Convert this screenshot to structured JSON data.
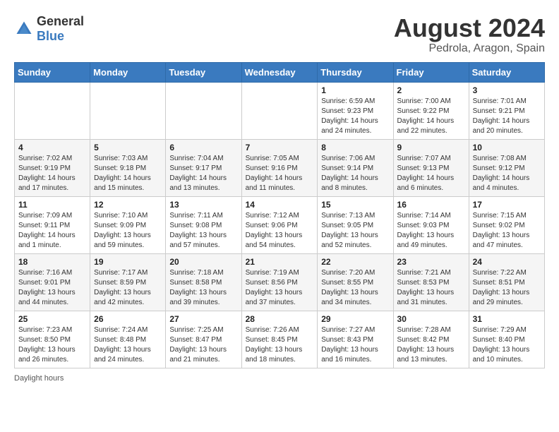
{
  "header": {
    "logo_general": "General",
    "logo_blue": "Blue",
    "month_year": "August 2024",
    "location": "Pedrola, Aragon, Spain"
  },
  "days_of_week": [
    "Sunday",
    "Monday",
    "Tuesday",
    "Wednesday",
    "Thursday",
    "Friday",
    "Saturday"
  ],
  "weeks": [
    [
      {
        "day": "",
        "sunrise": "",
        "sunset": "",
        "daylight": ""
      },
      {
        "day": "",
        "sunrise": "",
        "sunset": "",
        "daylight": ""
      },
      {
        "day": "",
        "sunrise": "",
        "sunset": "",
        "daylight": ""
      },
      {
        "day": "",
        "sunrise": "",
        "sunset": "",
        "daylight": ""
      },
      {
        "day": "1",
        "sunrise": "Sunrise: 6:59 AM",
        "sunset": "Sunset: 9:23 PM",
        "daylight": "Daylight: 14 hours and 24 minutes."
      },
      {
        "day": "2",
        "sunrise": "Sunrise: 7:00 AM",
        "sunset": "Sunset: 9:22 PM",
        "daylight": "Daylight: 14 hours and 22 minutes."
      },
      {
        "day": "3",
        "sunrise": "Sunrise: 7:01 AM",
        "sunset": "Sunset: 9:21 PM",
        "daylight": "Daylight: 14 hours and 20 minutes."
      }
    ],
    [
      {
        "day": "4",
        "sunrise": "Sunrise: 7:02 AM",
        "sunset": "Sunset: 9:19 PM",
        "daylight": "Daylight: 14 hours and 17 minutes."
      },
      {
        "day": "5",
        "sunrise": "Sunrise: 7:03 AM",
        "sunset": "Sunset: 9:18 PM",
        "daylight": "Daylight: 14 hours and 15 minutes."
      },
      {
        "day": "6",
        "sunrise": "Sunrise: 7:04 AM",
        "sunset": "Sunset: 9:17 PM",
        "daylight": "Daylight: 14 hours and 13 minutes."
      },
      {
        "day": "7",
        "sunrise": "Sunrise: 7:05 AM",
        "sunset": "Sunset: 9:16 PM",
        "daylight": "Daylight: 14 hours and 11 minutes."
      },
      {
        "day": "8",
        "sunrise": "Sunrise: 7:06 AM",
        "sunset": "Sunset: 9:14 PM",
        "daylight": "Daylight: 14 hours and 8 minutes."
      },
      {
        "day": "9",
        "sunrise": "Sunrise: 7:07 AM",
        "sunset": "Sunset: 9:13 PM",
        "daylight": "Daylight: 14 hours and 6 minutes."
      },
      {
        "day": "10",
        "sunrise": "Sunrise: 7:08 AM",
        "sunset": "Sunset: 9:12 PM",
        "daylight": "Daylight: 14 hours and 4 minutes."
      }
    ],
    [
      {
        "day": "11",
        "sunrise": "Sunrise: 7:09 AM",
        "sunset": "Sunset: 9:11 PM",
        "daylight": "Daylight: 14 hours and 1 minute."
      },
      {
        "day": "12",
        "sunrise": "Sunrise: 7:10 AM",
        "sunset": "Sunset: 9:09 PM",
        "daylight": "Daylight: 13 hours and 59 minutes."
      },
      {
        "day": "13",
        "sunrise": "Sunrise: 7:11 AM",
        "sunset": "Sunset: 9:08 PM",
        "daylight": "Daylight: 13 hours and 57 minutes."
      },
      {
        "day": "14",
        "sunrise": "Sunrise: 7:12 AM",
        "sunset": "Sunset: 9:06 PM",
        "daylight": "Daylight: 13 hours and 54 minutes."
      },
      {
        "day": "15",
        "sunrise": "Sunrise: 7:13 AM",
        "sunset": "Sunset: 9:05 PM",
        "daylight": "Daylight: 13 hours and 52 minutes."
      },
      {
        "day": "16",
        "sunrise": "Sunrise: 7:14 AM",
        "sunset": "Sunset: 9:03 PM",
        "daylight": "Daylight: 13 hours and 49 minutes."
      },
      {
        "day": "17",
        "sunrise": "Sunrise: 7:15 AM",
        "sunset": "Sunset: 9:02 PM",
        "daylight": "Daylight: 13 hours and 47 minutes."
      }
    ],
    [
      {
        "day": "18",
        "sunrise": "Sunrise: 7:16 AM",
        "sunset": "Sunset: 9:01 PM",
        "daylight": "Daylight: 13 hours and 44 minutes."
      },
      {
        "day": "19",
        "sunrise": "Sunrise: 7:17 AM",
        "sunset": "Sunset: 8:59 PM",
        "daylight": "Daylight: 13 hours and 42 minutes."
      },
      {
        "day": "20",
        "sunrise": "Sunrise: 7:18 AM",
        "sunset": "Sunset: 8:58 PM",
        "daylight": "Daylight: 13 hours and 39 minutes."
      },
      {
        "day": "21",
        "sunrise": "Sunrise: 7:19 AM",
        "sunset": "Sunset: 8:56 PM",
        "daylight": "Daylight: 13 hours and 37 minutes."
      },
      {
        "day": "22",
        "sunrise": "Sunrise: 7:20 AM",
        "sunset": "Sunset: 8:55 PM",
        "daylight": "Daylight: 13 hours and 34 minutes."
      },
      {
        "day": "23",
        "sunrise": "Sunrise: 7:21 AM",
        "sunset": "Sunset: 8:53 PM",
        "daylight": "Daylight: 13 hours and 31 minutes."
      },
      {
        "day": "24",
        "sunrise": "Sunrise: 7:22 AM",
        "sunset": "Sunset: 8:51 PM",
        "daylight": "Daylight: 13 hours and 29 minutes."
      }
    ],
    [
      {
        "day": "25",
        "sunrise": "Sunrise: 7:23 AM",
        "sunset": "Sunset: 8:50 PM",
        "daylight": "Daylight: 13 hours and 26 minutes."
      },
      {
        "day": "26",
        "sunrise": "Sunrise: 7:24 AM",
        "sunset": "Sunset: 8:48 PM",
        "daylight": "Daylight: 13 hours and 24 minutes."
      },
      {
        "day": "27",
        "sunrise": "Sunrise: 7:25 AM",
        "sunset": "Sunset: 8:47 PM",
        "daylight": "Daylight: 13 hours and 21 minutes."
      },
      {
        "day": "28",
        "sunrise": "Sunrise: 7:26 AM",
        "sunset": "Sunset: 8:45 PM",
        "daylight": "Daylight: 13 hours and 18 minutes."
      },
      {
        "day": "29",
        "sunrise": "Sunrise: 7:27 AM",
        "sunset": "Sunset: 8:43 PM",
        "daylight": "Daylight: 13 hours and 16 minutes."
      },
      {
        "day": "30",
        "sunrise": "Sunrise: 7:28 AM",
        "sunset": "Sunset: 8:42 PM",
        "daylight": "Daylight: 13 hours and 13 minutes."
      },
      {
        "day": "31",
        "sunrise": "Sunrise: 7:29 AM",
        "sunset": "Sunset: 8:40 PM",
        "daylight": "Daylight: 13 hours and 10 minutes."
      }
    ]
  ],
  "footer": {
    "note": "Daylight hours"
  }
}
